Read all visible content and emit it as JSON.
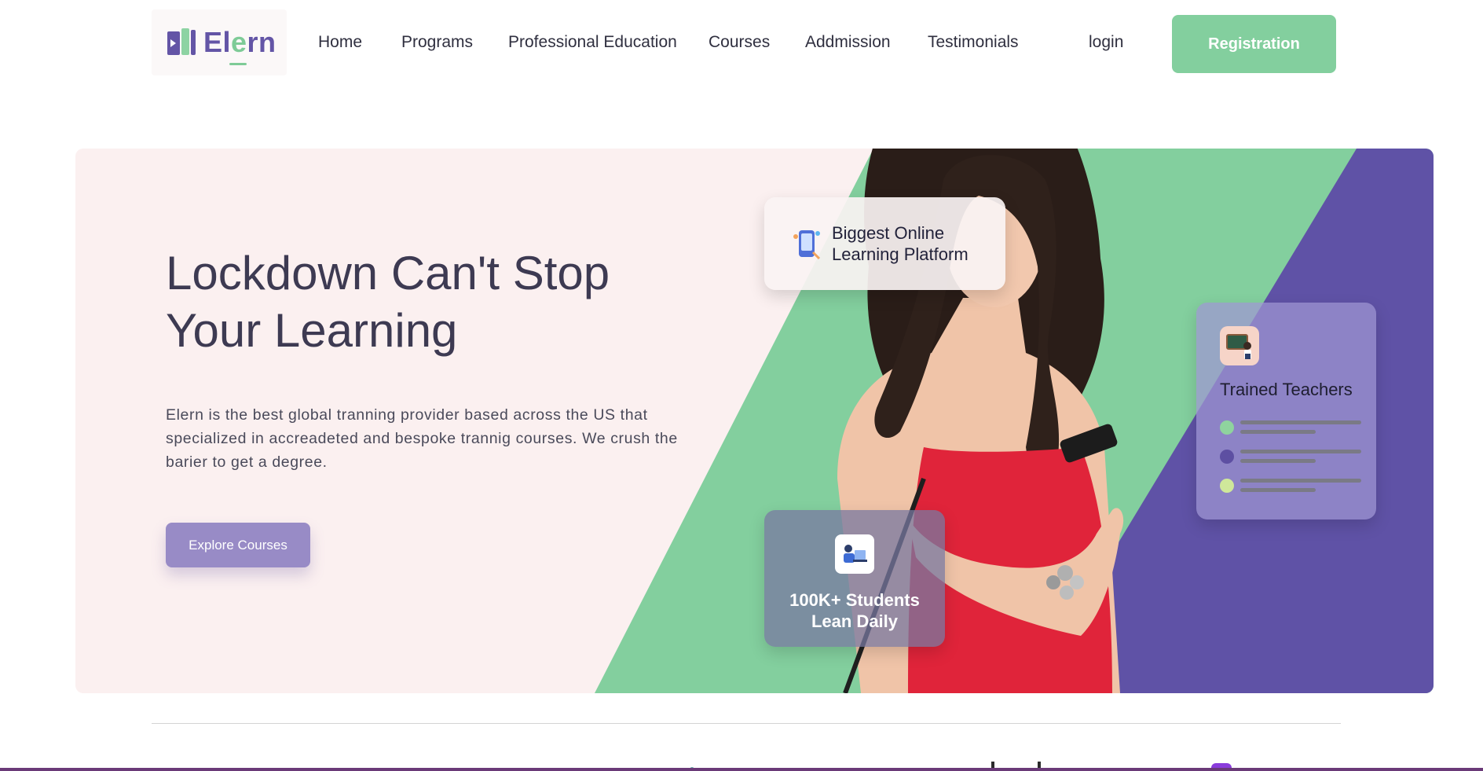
{
  "brand": {
    "name_part1": "El",
    "name_accent": "e",
    "name_part2": "rn",
    "colors": {
      "primary": "#6355a6",
      "accent": "#83cf9e",
      "hero_bg": "#fbf0f0",
      "button": "#988bc6"
    }
  },
  "nav": {
    "items": [
      {
        "label": "Home"
      },
      {
        "label": "Programs"
      },
      {
        "label": "Professional Education"
      },
      {
        "label": "Courses"
      },
      {
        "label": "Addmission"
      },
      {
        "label": "Testimonials"
      }
    ],
    "login": "login",
    "register": "Registration"
  },
  "hero": {
    "title_line1": "Lockdown Can't Stop",
    "title_line2": "Your Learning",
    "description": "Elern is the best global tranning provider based across the US that specialized in accreadeted and bespoke trannig courses. We crush the barier to get a degree.",
    "cta": "Explore Courses"
  },
  "cards": {
    "platform": {
      "line1": "Biggest Online",
      "line2": "Learning Platform",
      "icon": "mobile-learning-icon"
    },
    "students": {
      "line1": "100K+ Students",
      "line2": "Lean Daily",
      "icon": "student-laptop-icon"
    },
    "teachers": {
      "title": "Trained Teachers",
      "icon": "teacher-blackboard-icon",
      "bullet_colors": [
        "#8fd39e",
        "#5d4fa2",
        "#cfe89a"
      ]
    }
  }
}
